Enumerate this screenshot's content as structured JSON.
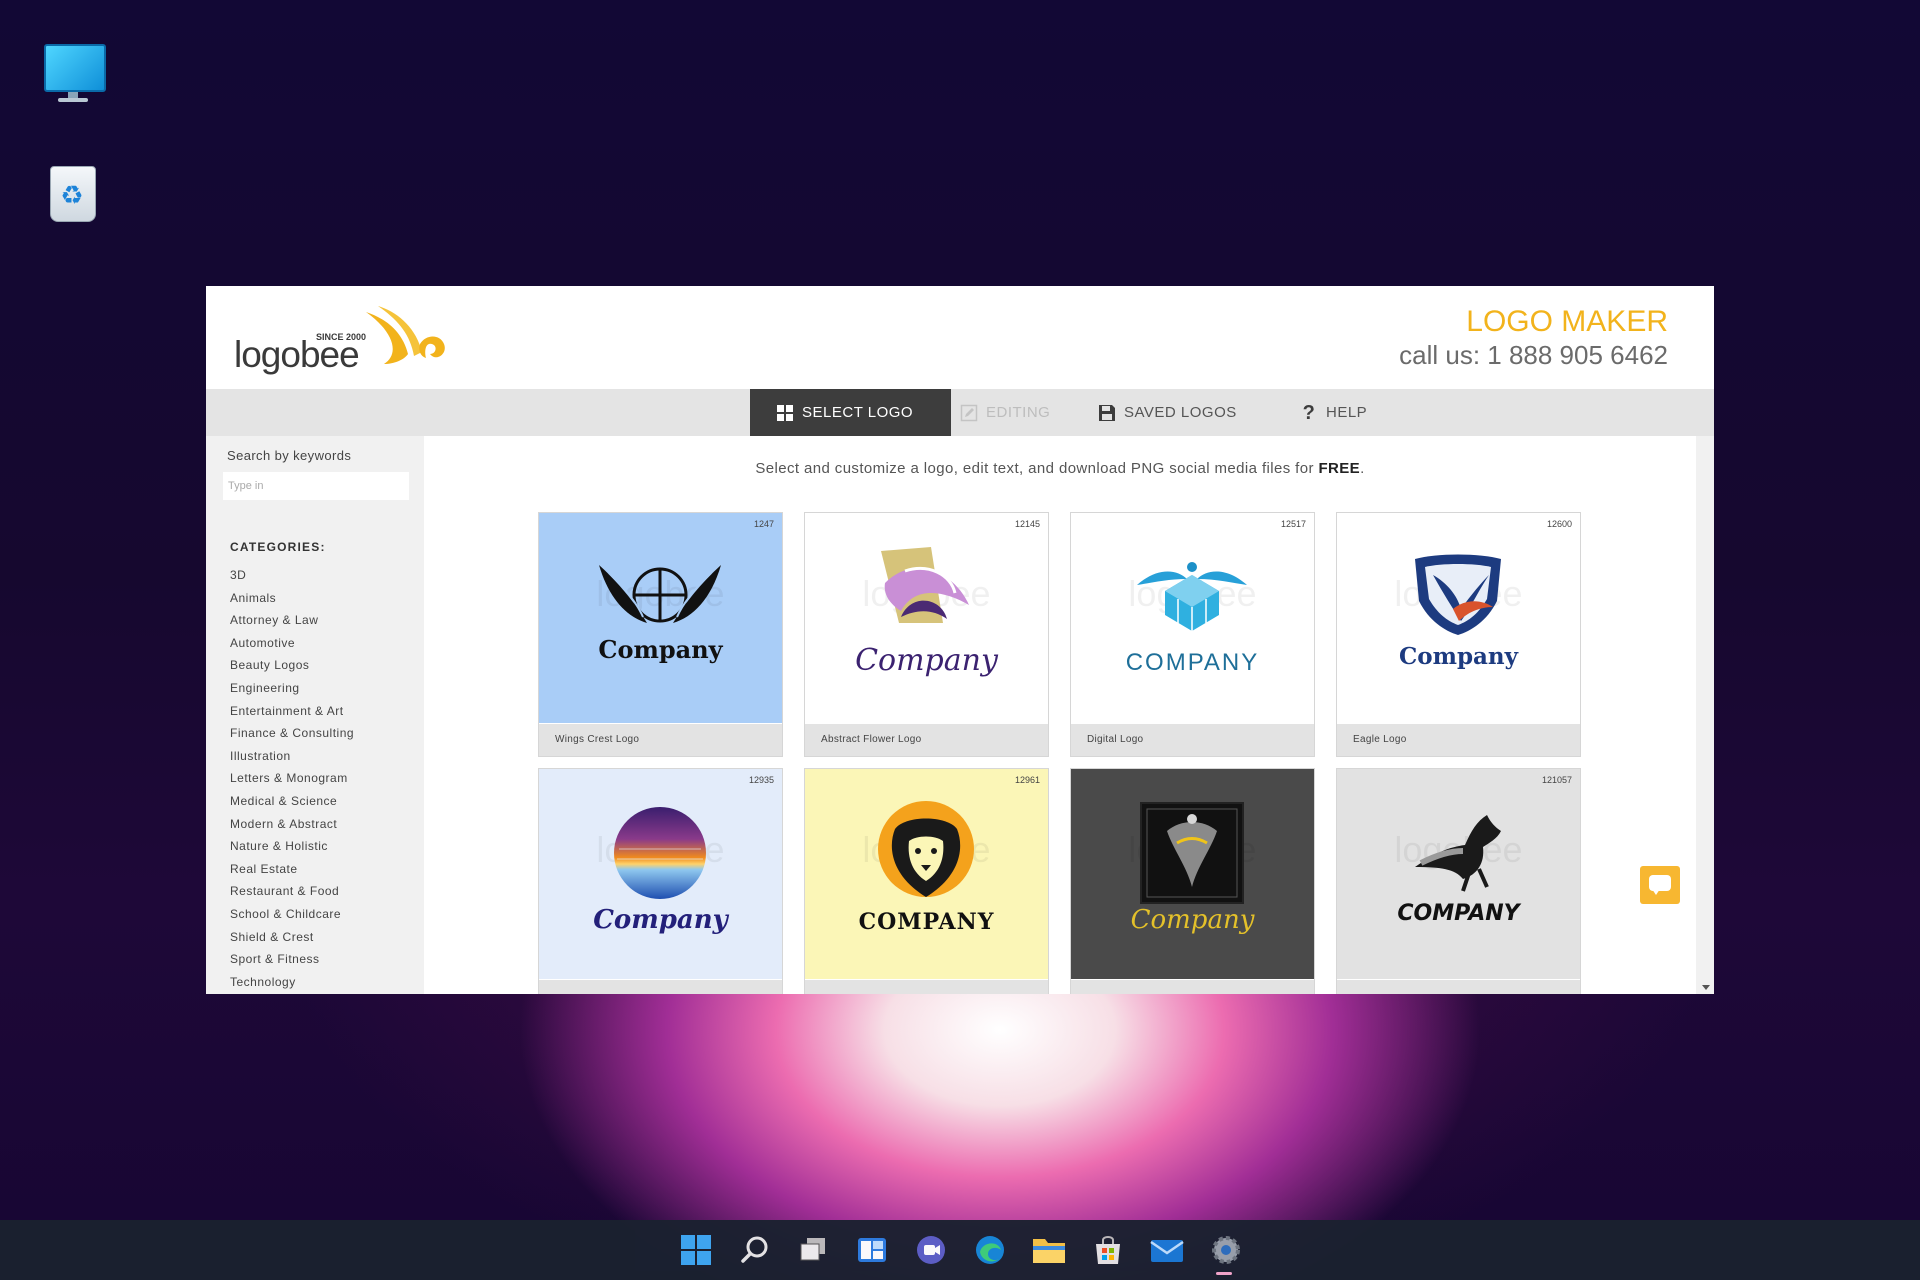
{
  "header": {
    "logo_text": "logobee",
    "logo_since": "SINCE 2000",
    "title": "LOGO MAKER",
    "phone": "call us: 1 888 905 6462"
  },
  "nav": {
    "tabs": [
      {
        "label": "SELECT LOGO",
        "state": "active"
      },
      {
        "label": "EDITING",
        "state": "disabled"
      },
      {
        "label": "SAVED LOGOS",
        "state": "normal"
      },
      {
        "label": "HELP",
        "state": "normal"
      }
    ]
  },
  "sidebar": {
    "search_label": "Search by keywords",
    "search_placeholder": "Type in",
    "categories_title": "CATEGORIES:",
    "categories": [
      "3D",
      "Animals",
      "Attorney & Law",
      "Automotive",
      "Beauty Logos",
      "Engineering",
      "Entertainment & Art",
      "Finance & Consulting",
      "Illustration",
      "Letters & Monogram",
      "Medical & Science",
      "Modern & Abstract",
      "Nature & Holistic",
      "Real Estate",
      "Restaurant & Food",
      "School & Childcare",
      "Shield & Crest",
      "Sport & Fitness",
      "Technology"
    ]
  },
  "intro": {
    "text": "Select and customize a logo, edit text, and download PNG social media files for ",
    "bold": "FREE",
    "end": "."
  },
  "logos": [
    {
      "id": "1247",
      "name": "Wings Crest Logo",
      "company": "Company",
      "bg": "#a9cdf7"
    },
    {
      "id": "12145",
      "name": "Abstract Flower Logo",
      "company": "Company",
      "bg": "#ffffff"
    },
    {
      "id": "12517",
      "name": "Digital Logo",
      "company": "COMPANY",
      "bg": "#ffffff"
    },
    {
      "id": "12600",
      "name": "Eagle Logo",
      "company": "Company",
      "bg": "#ffffff"
    },
    {
      "id": "12935",
      "name": "",
      "company": "Company",
      "bg": "#e3ecfa"
    },
    {
      "id": "12961",
      "name": "",
      "company": "COMPANY",
      "bg": "#fbf6b7"
    },
    {
      "id": "",
      "name": "",
      "company": "Company",
      "bg": "#4a4a4a"
    },
    {
      "id": "121057",
      "name": "",
      "company": "COMPANY",
      "bg": "#e2e2e2"
    }
  ],
  "watermark": "logobee",
  "colors": {
    "brand_yellow": "#f2b31c",
    "nav_active": "#3d3d3d"
  },
  "taskbar_icons": [
    "windows-start-icon",
    "search-icon",
    "task-view-icon",
    "widgets-icon",
    "teams-chat-icon",
    "edge-browser-icon",
    "file-explorer-icon",
    "microsoft-store-icon",
    "mail-icon",
    "settings-icon"
  ]
}
